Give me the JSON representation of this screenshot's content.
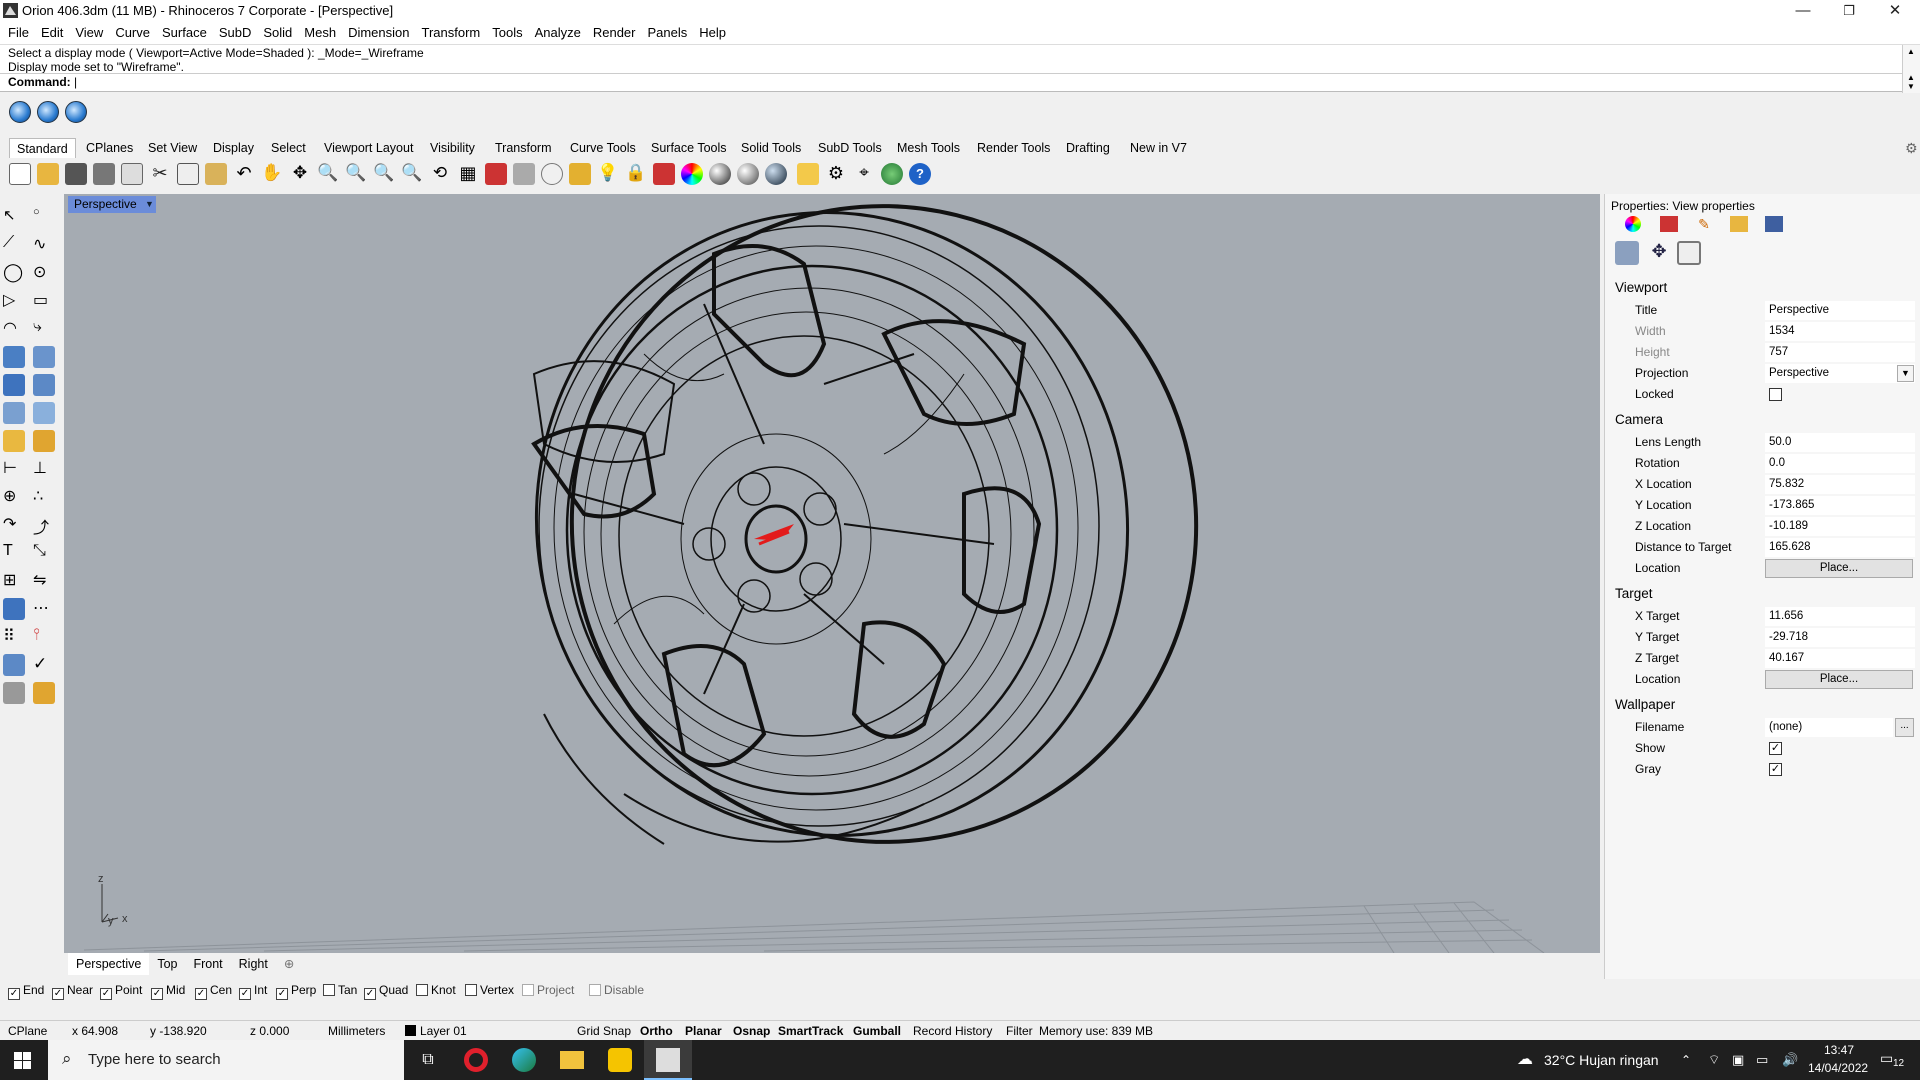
{
  "window": {
    "title": "Orion 406.3dm (11 MB) - Rhinoceros 7 Corporate - [Perspective]",
    "minimize": "—",
    "restore": "❐",
    "close": "✕"
  },
  "menu": [
    "File",
    "Edit",
    "View",
    "Curve",
    "Surface",
    "SubD",
    "Solid",
    "Mesh",
    "Dimension",
    "Transform",
    "Tools",
    "Analyze",
    "Render",
    "Panels",
    "Help"
  ],
  "command": {
    "history1": "Select a display mode ( Viewport=Active  Mode=Shaded ): _Mode=_Wireframe",
    "history2": "Display mode set to \"Wireframe\".",
    "prompt": "Command:"
  },
  "toolbar_tabs": [
    "Standard",
    "CPlanes",
    "Set View",
    "Display",
    "Select",
    "Viewport Layout",
    "Visibility",
    "Transform",
    "Curve Tools",
    "Surface Tools",
    "Solid Tools",
    "SubD Tools",
    "Mesh Tools",
    "Render Tools",
    "Drafting",
    "New in V7"
  ],
  "viewport": {
    "label": "Perspective",
    "axis_x": "x",
    "axis_y": "y",
    "axis_z": "z"
  },
  "viewport_tabs": [
    "Perspective",
    "Top",
    "Front",
    "Right"
  ],
  "properties": {
    "header": "Properties: View properties",
    "viewport_section": "Viewport",
    "camera_section": "Camera",
    "target_section": "Target",
    "wallpaper_section": "Wallpaper",
    "title_label": "Title",
    "title_value": "Perspective",
    "width_label": "Width",
    "width_value": "1534",
    "height_label": "Height",
    "height_value": "757",
    "projection_label": "Projection",
    "projection_value": "Perspective",
    "locked_label": "Locked",
    "lens_label": "Lens Length",
    "lens_value": "50.0",
    "rotation_label": "Rotation",
    "rotation_value": "0.0",
    "xloc_label": "X Location",
    "xloc_value": "75.832",
    "yloc_label": "Y Location",
    "yloc_value": "-173.865",
    "zloc_label": "Z Location",
    "zloc_value": "-10.189",
    "dist_label": "Distance to Target",
    "dist_value": "165.628",
    "location_label": "Location",
    "place_button": "Place...",
    "xtgt_label": "X Target",
    "xtgt_value": "11.656",
    "ytgt_label": "Y Target",
    "ytgt_value": "-29.718",
    "ztgt_label": "Z Target",
    "ztgt_value": "40.167",
    "tloc_label": "Location",
    "filename_label": "Filename",
    "filename_value": "(none)",
    "filename_browse": "...",
    "show_label": "Show",
    "gray_label": "Gray",
    "locked_checked": false,
    "show_checked": true,
    "gray_checked": true
  },
  "osnaps": [
    {
      "label": "End",
      "checked": true
    },
    {
      "label": "Near",
      "checked": true
    },
    {
      "label": "Point",
      "checked": true
    },
    {
      "label": "Mid",
      "checked": true
    },
    {
      "label": "Cen",
      "checked": true
    },
    {
      "label": "Int",
      "checked": true
    },
    {
      "label": "Perp",
      "checked": true
    },
    {
      "label": "Tan",
      "checked": false
    },
    {
      "label": "Quad",
      "checked": true
    },
    {
      "label": "Knot",
      "checked": false
    },
    {
      "label": "Vertex",
      "checked": false
    },
    {
      "label": "Project",
      "checked": false
    },
    {
      "label": "Disable",
      "checked": false
    }
  ],
  "status": {
    "cplane": "CPlane",
    "x": "x 64.908",
    "y": "y -138.920",
    "z": "z 0.000",
    "units": "Millimeters",
    "layer": "Layer 01",
    "grid_snap": "Grid Snap",
    "ortho": "Ortho",
    "planar": "Planar",
    "osnap": "Osnap",
    "smarttrack": "SmartTrack",
    "gumball": "Gumball",
    "record_history": "Record History",
    "filter": "Filter",
    "memory": "Memory use: 839 MB"
  },
  "taskbar": {
    "search_placeholder": "Type here to search",
    "weather": "32°C  Hujan ringan",
    "time": "13:47",
    "date": "14/04/2022",
    "notif_count": "12"
  },
  "colors": {
    "viewport_bg": "#a5abb2",
    "viewport_label": "#6b8cd9",
    "taskbar": "#1f1f1f"
  }
}
